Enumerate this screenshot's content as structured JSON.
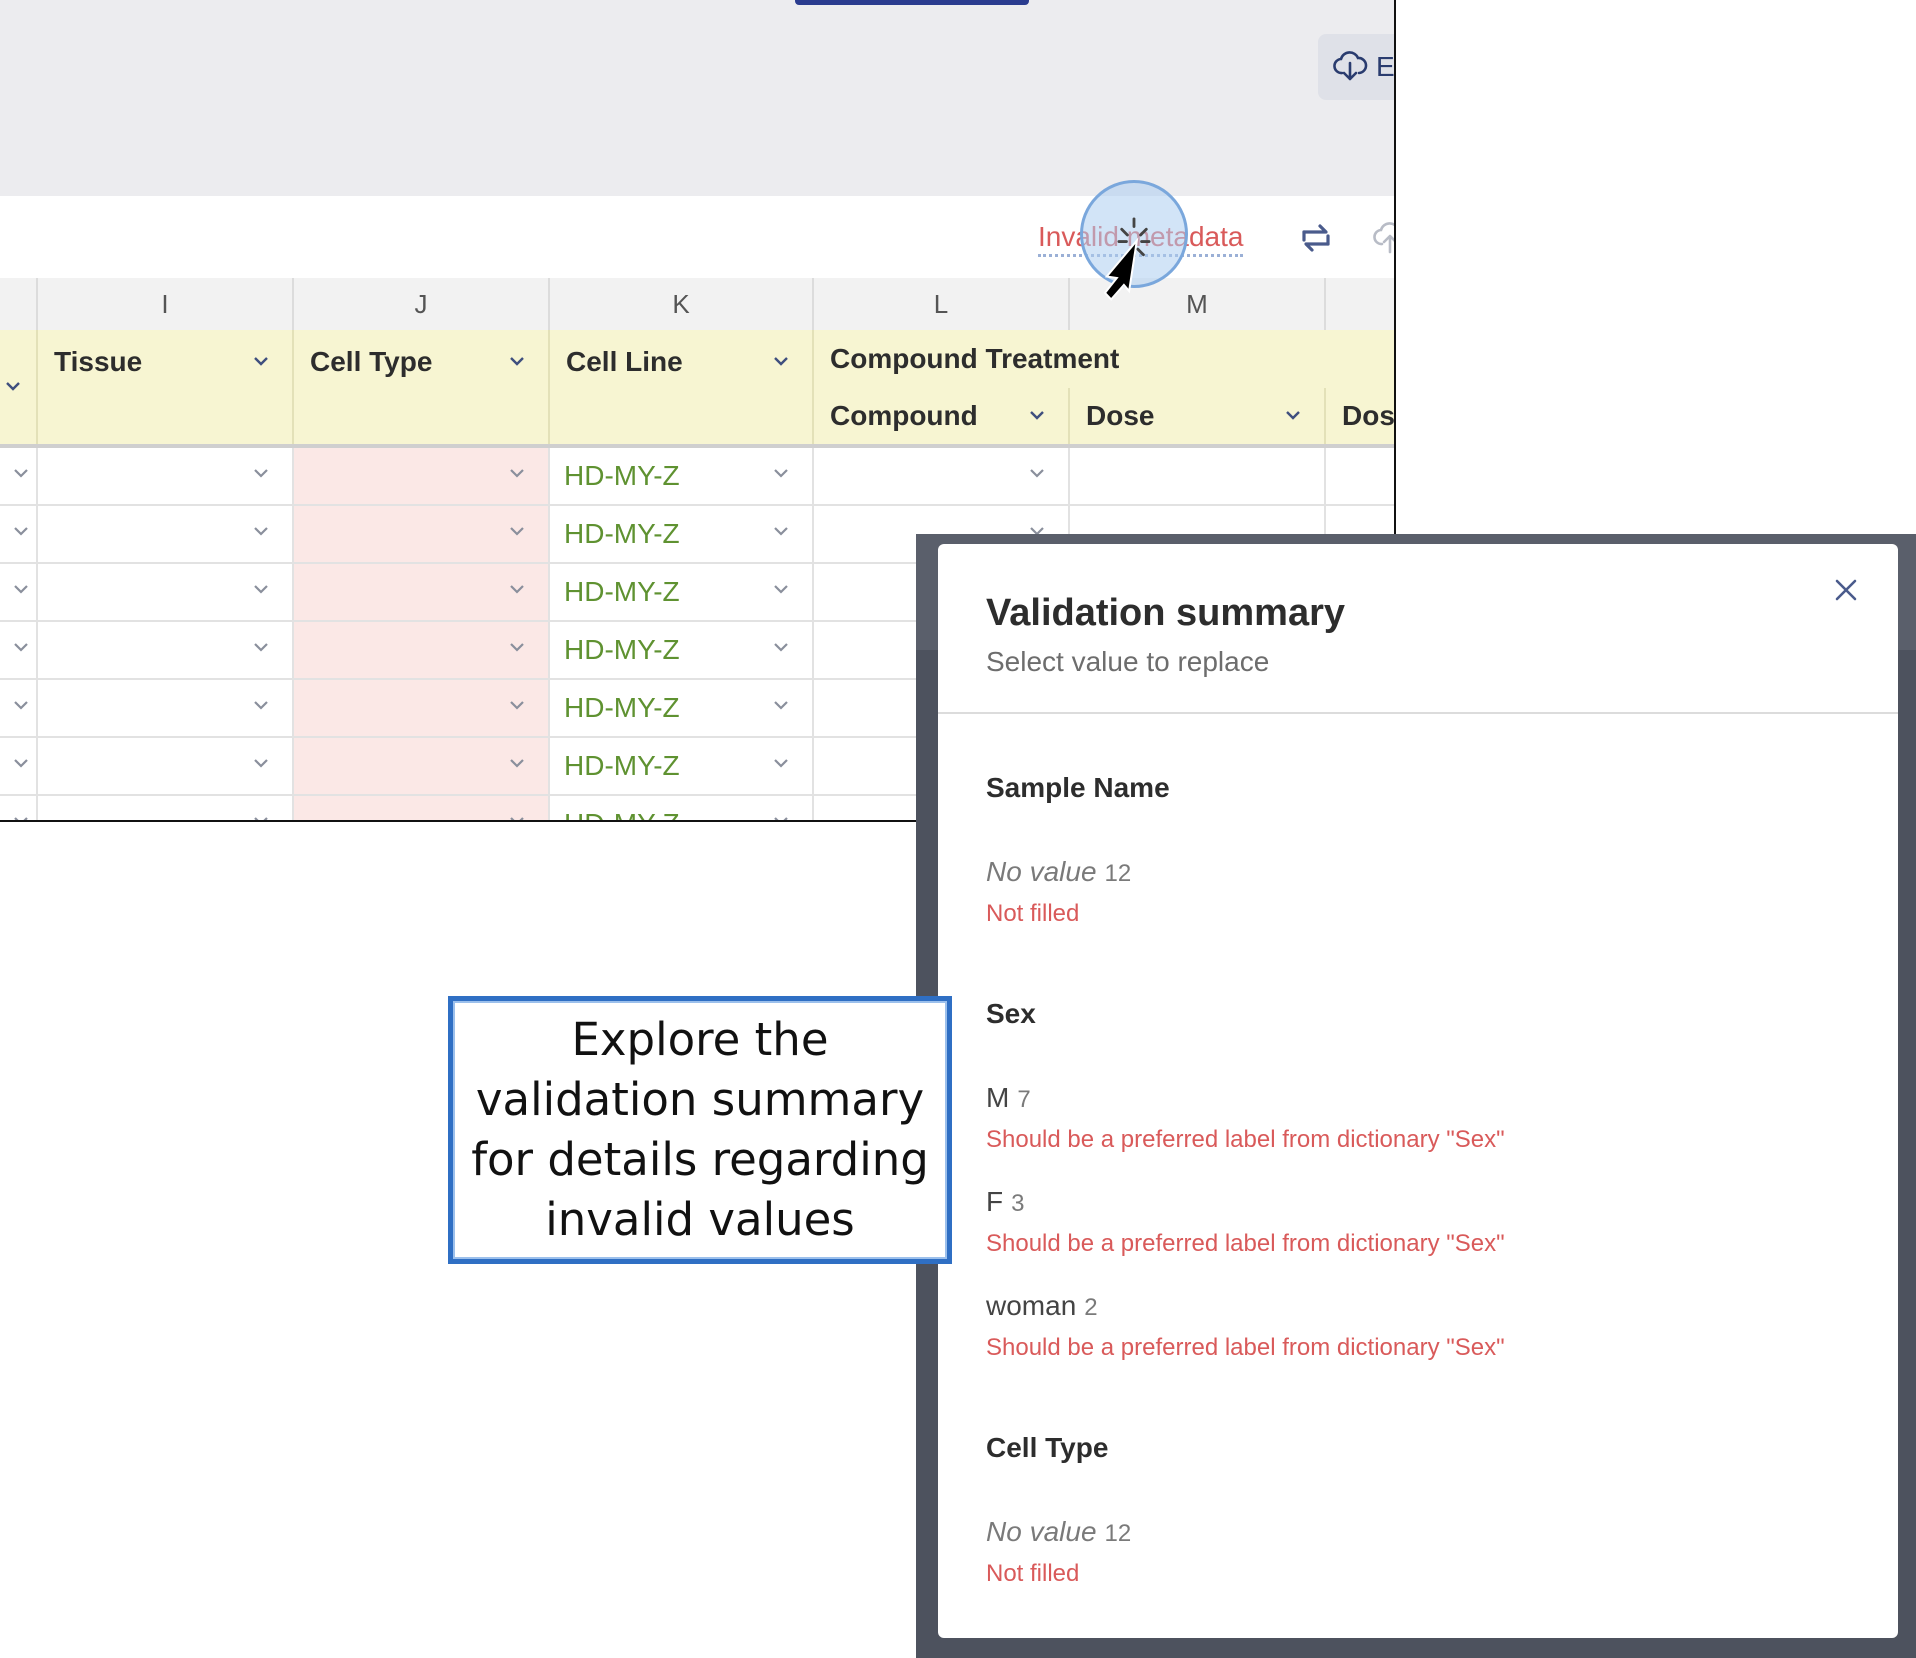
{
  "toolbar": {
    "export_label": "E:",
    "invalid_metadata_link": "Invalid metadata"
  },
  "grid": {
    "column_letters": [
      "I",
      "J",
      "K",
      "L",
      "M"
    ],
    "headers": {
      "tissue": "Tissue",
      "cell_type": "Cell Type",
      "cell_line": "Cell Line",
      "compound_treatment_group": "Compound Treatment",
      "compound": "Compound",
      "dose": "Dose",
      "dose_partial": "Dose"
    },
    "rows": [
      {
        "cell_line": "HD-MY-Z"
      },
      {
        "cell_line": "HD-MY-Z"
      },
      {
        "cell_line": "HD-MY-Z"
      },
      {
        "cell_line": "HD-MY-Z"
      },
      {
        "cell_line": "HD-MY-Z"
      },
      {
        "cell_line": "HD-MY-Z"
      },
      {
        "cell_line": "HD-MY-Z"
      }
    ]
  },
  "validation_summary": {
    "title": "Validation summary",
    "subtitle": "Select value to replace",
    "sections": [
      {
        "title": "Sample Name",
        "items": [
          {
            "value": "No value",
            "count": "12",
            "error": "Not filled"
          }
        ]
      },
      {
        "title": "Sex",
        "items": [
          {
            "value": "M",
            "count": "7",
            "error": "Should be a preferred label from dictionary \"Sex\""
          },
          {
            "value": "F",
            "count": "3",
            "error": "Should be a preferred label from dictionary \"Sex\""
          },
          {
            "value": "woman",
            "count": "2",
            "error": "Should be a preferred label from dictionary \"Sex\""
          }
        ]
      },
      {
        "title": "Cell Type",
        "items": [
          {
            "value": "No value",
            "count": "12",
            "error": "Not filled"
          }
        ]
      }
    ]
  },
  "callout": {
    "text": "Explore the validation summary for details regarding invalid values"
  },
  "colors": {
    "header_bg": "#f7f5d2",
    "invalid_cell_bg": "#fbe8e6",
    "valid_text": "#5f9231",
    "error_text": "#d95a5a",
    "callout_border": "#2f6fc4"
  },
  "icons": [
    "cloud-download-icon",
    "sync-icon",
    "cloud-upload-icon",
    "chevron-down-icon",
    "close-icon",
    "cursor-icon"
  ]
}
